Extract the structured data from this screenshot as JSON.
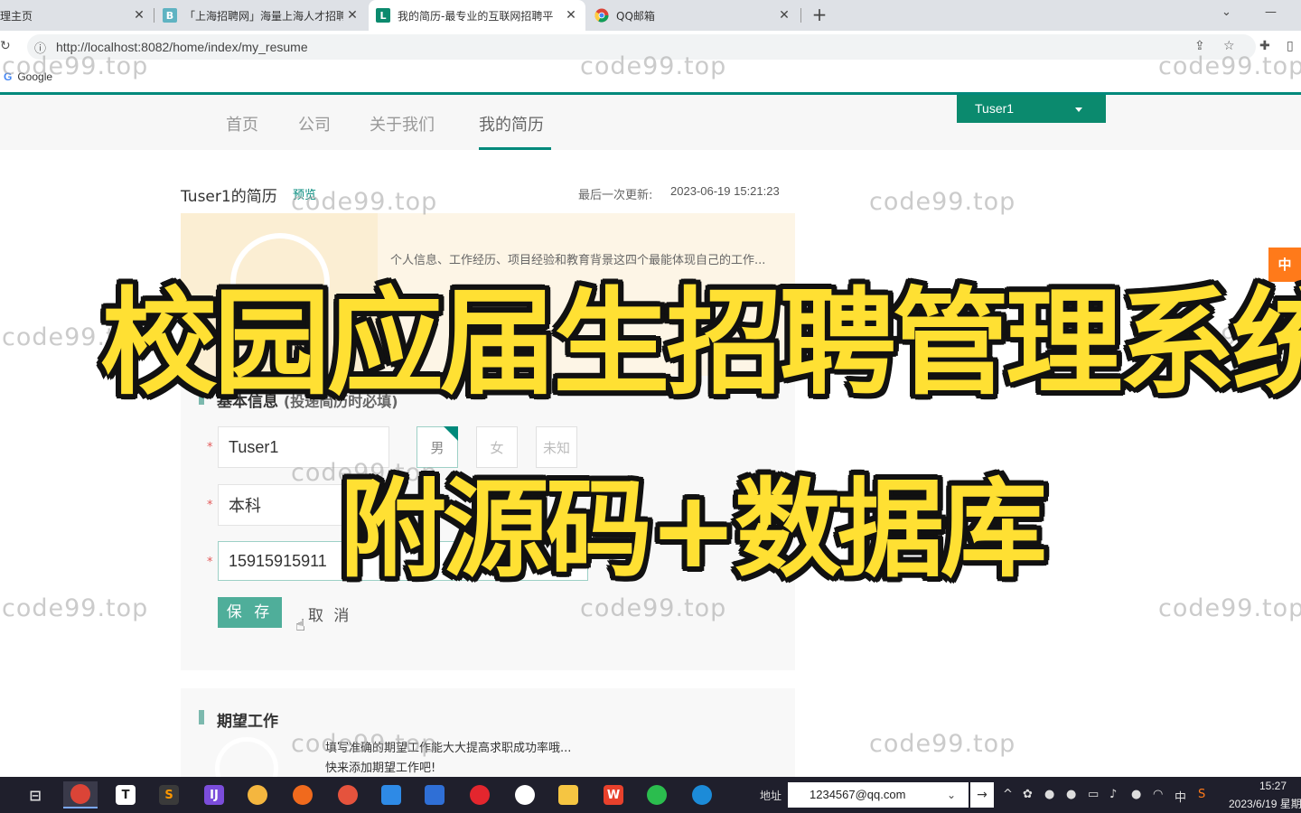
{
  "browser": {
    "tabs": [
      {
        "title": "理主页",
        "favicon": ""
      },
      {
        "title": "「上海招聘网」海量上海人才招聘",
        "favicon": "B"
      },
      {
        "title": "我的简历-最专业的互联网招聘平",
        "favicon": "L"
      },
      {
        "title": "QQ邮箱",
        "favicon": "chrome-icon"
      }
    ],
    "new_tab": "+",
    "url": "http://localhost:8082/home/index/my_resume",
    "bookmark": "Google"
  },
  "site": {
    "nav": [
      "首页",
      "公司",
      "关于我们",
      "我的简历"
    ],
    "active_nav": "我的简历",
    "user": "Tuser1",
    "accent_color": "#00897b"
  },
  "resume": {
    "title": "Tuser1的简历",
    "preview_label": "预览",
    "updated_label": "最后一次更新:",
    "updated_time": "2023-06-19 15:21:23",
    "profile_tip": "个人信息、工作经历、项目经验和教育背景这四个最能体现自己的工作...",
    "basic_info": {
      "title": "基本信息",
      "subtitle": "(投递简历时必填)",
      "name": "Tuser1",
      "gender_options": [
        "男",
        "女",
        "未知"
      ],
      "selected_gender": "男",
      "education": "本科",
      "phone": "15915915911",
      "save_label": "保 存",
      "cancel_label": "取 消"
    },
    "expect": {
      "title": "期望工作",
      "tip1": "填写准确的期望工作能大大提高求职成功率哦...",
      "tip2": "快来添加期望工作吧!"
    },
    "side_button": "中"
  },
  "overlay": {
    "main_title": "校园应届生招聘管理系统",
    "sub_title": "附源码+数据库",
    "watermark": "code99.top"
  },
  "taskbar": {
    "address_label": "地址",
    "address_value": "1234567@qq.com",
    "ime": "中",
    "time": "15:27",
    "date": "2023/6/19 星期"
  }
}
